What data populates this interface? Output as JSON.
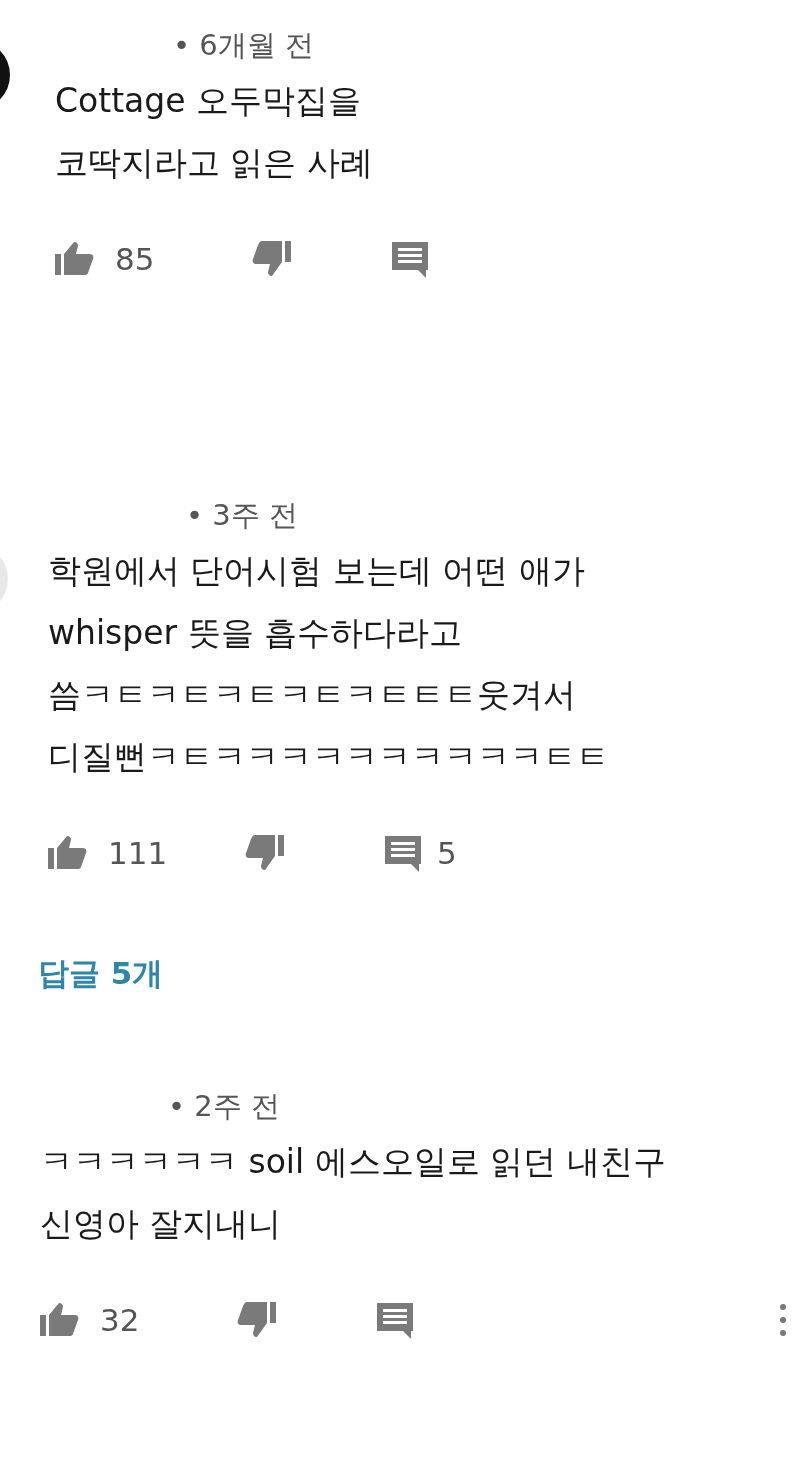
{
  "comments": [
    {
      "time": "• 6개월 전",
      "text": "Cottage 오두막집을\n코딱지라고 읽은 사례",
      "likes": "85",
      "menu": false
    },
    {
      "time": "• 3주 전",
      "text": "학원에서 단어시험 보는데 어떤 애가\nwhisper 뜻을 흡수하다라고\n씀ㅋㅌㅋㅌㅋㅌㅋㅌㅋㅌㅌㅌ웃겨서\n디질뻔ㅋㅌㅋㅋㅋㅋㅋㅋㅋㅋㅋㅋㅌㅌ",
      "likes": "111",
      "reply_count": "5",
      "replies_link": "답글 5개",
      "menu": false
    },
    {
      "time": "• 2주 전",
      "text": "ㅋㅋㅋㅋㅋㅋ soil 에스오일로 읽던 내친구\n신영아 잘지내니",
      "likes": "32",
      "menu": true
    }
  ]
}
